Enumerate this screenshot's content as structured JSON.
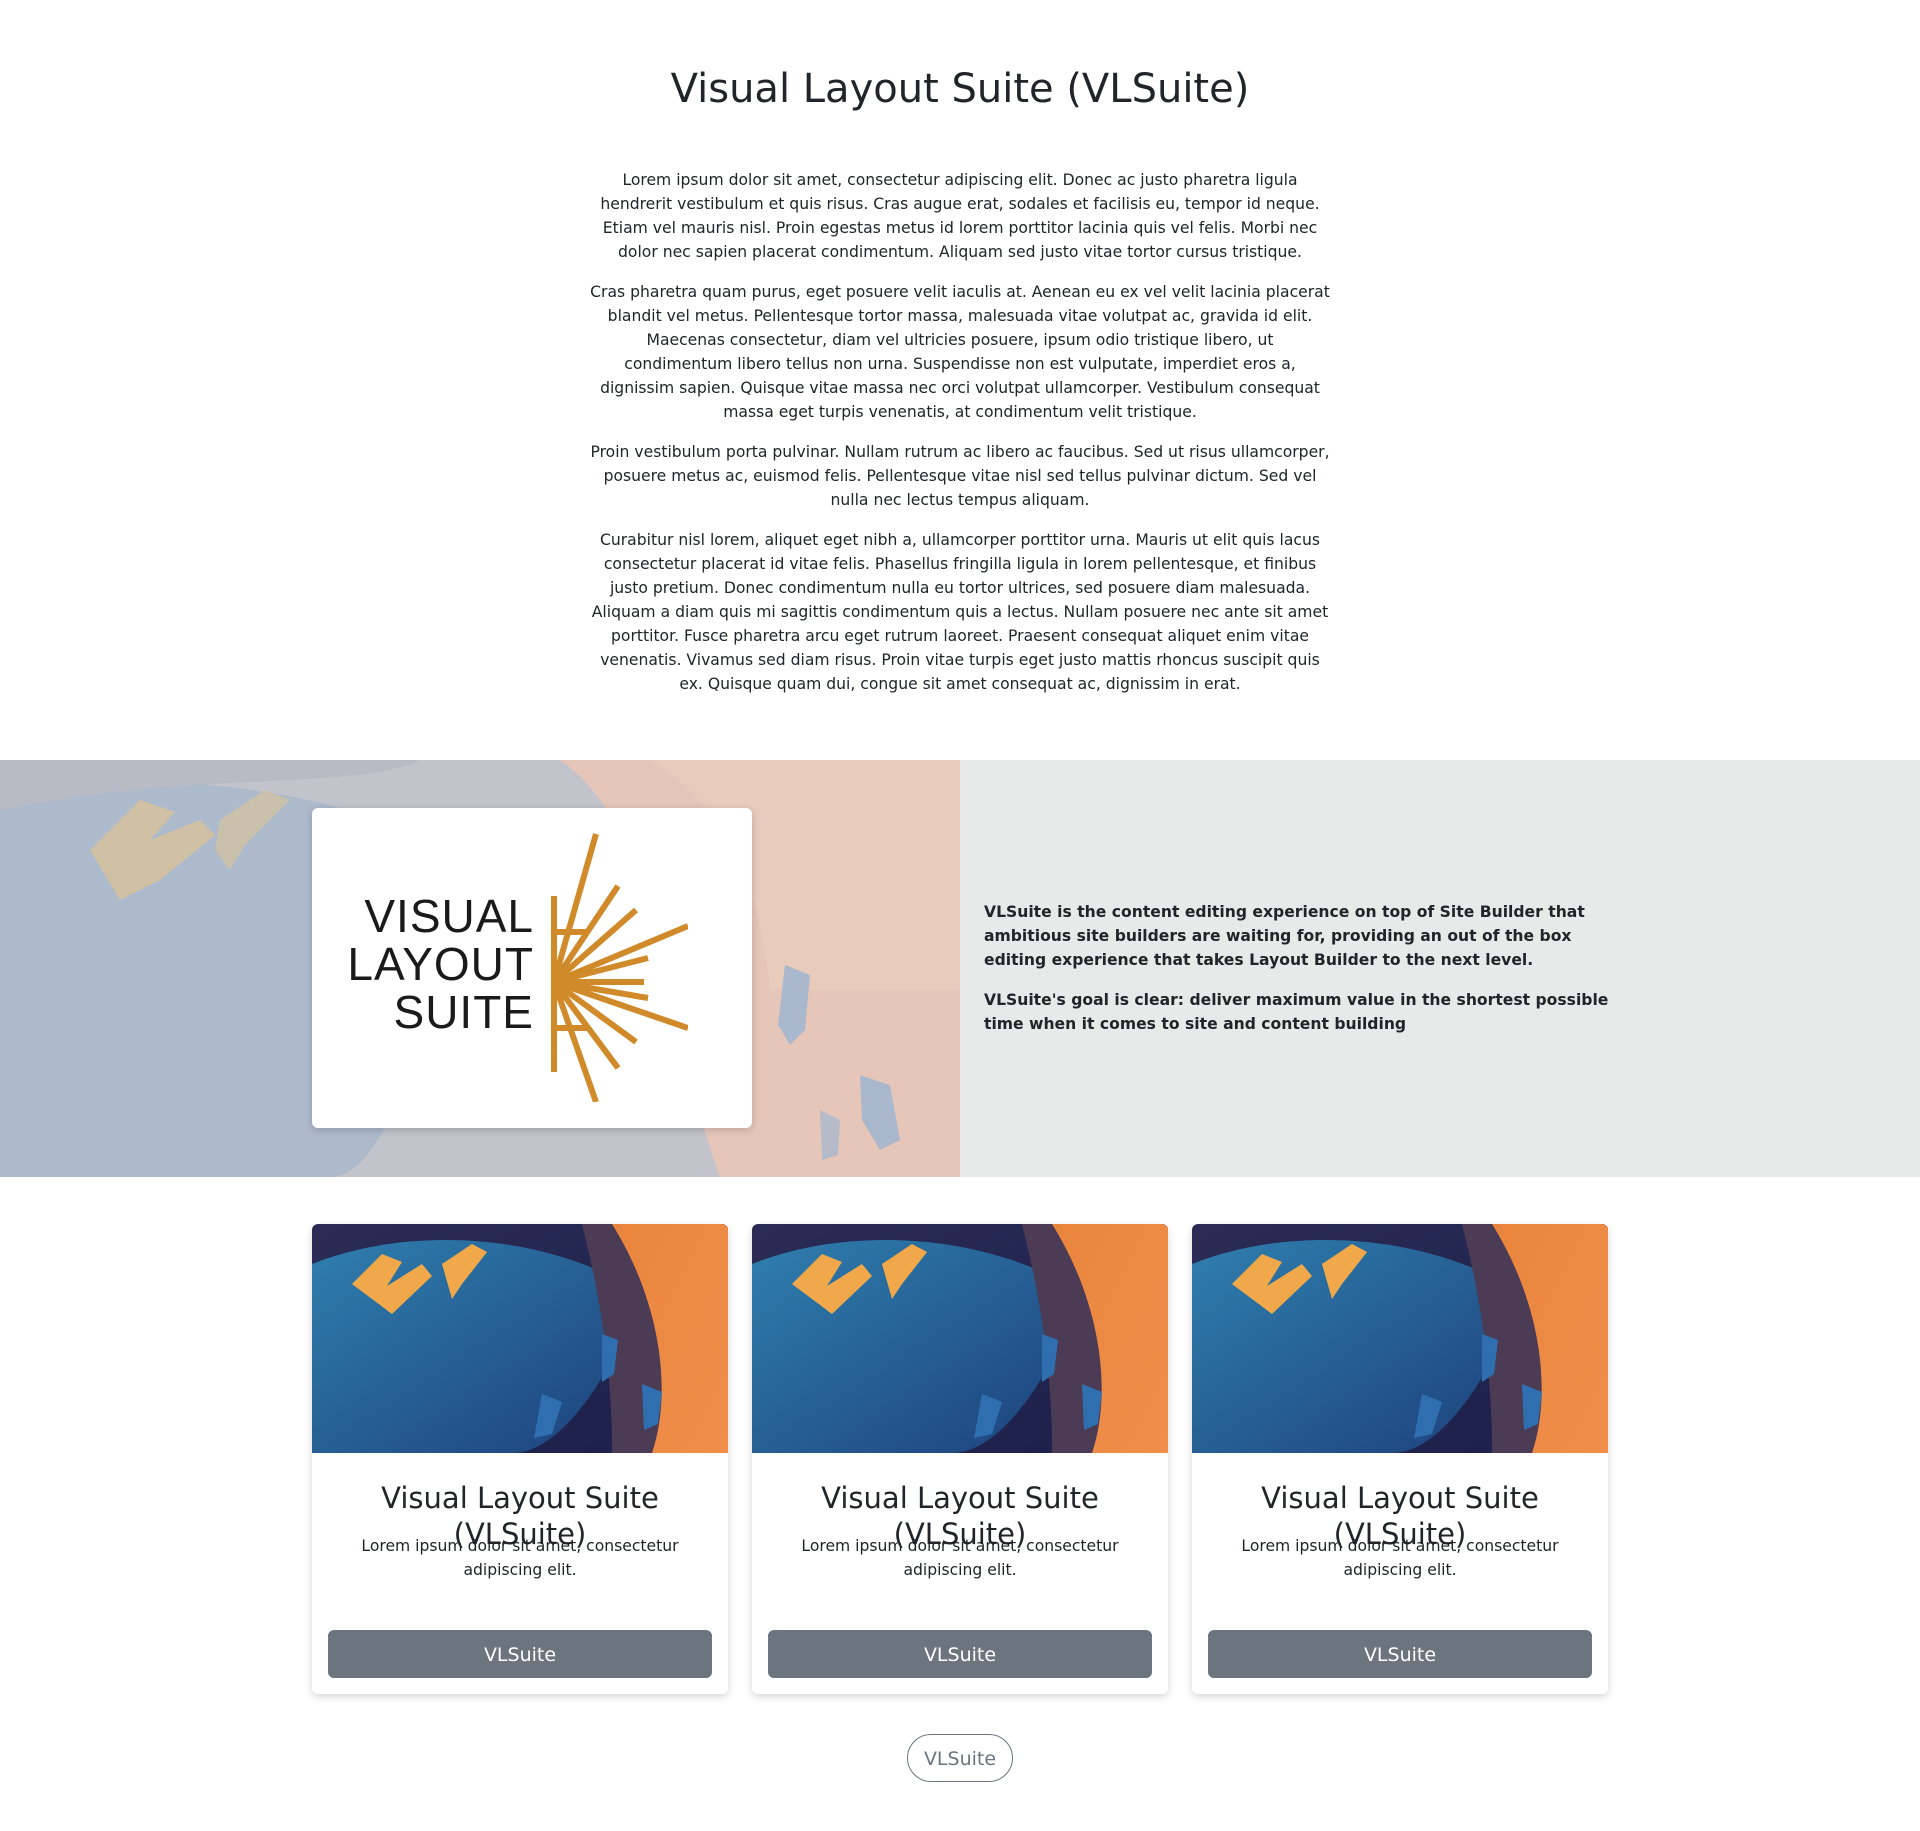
{
  "page": {
    "title": "Visual Layout Suite (VLSuite)"
  },
  "intro": {
    "paragraphs": [
      "Lorem ipsum dolor sit amet, consectetur adipiscing elit. Donec ac justo pharetra ligula hendrerit vestibulum et quis risus. Cras augue erat, sodales et facilisis eu, tempor id neque. Etiam vel mauris nisl. Proin egestas metus id lorem porttitor lacinia quis vel felis. Morbi nec dolor nec sapien placerat condimentum. Aliquam sed justo vitae tortor cursus tristique.",
      "Cras pharetra quam purus, eget posuere velit iaculis at. Aenean eu ex vel velit lacinia placerat blandit vel metus. Pellentesque tortor massa, malesuada vitae volutpat ac, gravida id elit. Maecenas consectetur, diam vel ultricies posuere, ipsum odio tristique libero, ut condimentum libero tellus non urna. Suspendisse non est vulputate, imperdiet eros a, dignissim sapien. Quisque vitae massa nec orci volutpat ullamcorper. Vestibulum consequat massa eget turpis venenatis, at condimentum velit tristique.",
      "Proin vestibulum porta pulvinar. Nullam rutrum ac libero ac faucibus. Sed ut risus ullamcorper, posuere metus ac, euismod felis. Pellentesque vitae nisl sed tellus pulvinar dictum. Sed vel nulla nec lectus tempus aliquam.",
      "Curabitur nisl lorem, aliquet eget nibh a, ullamcorper porttitor urna. Mauris ut elit quis lacus consectetur placerat id vitae felis. Phasellus fringilla ligula in lorem pellentesque, et finibus justo pretium. Donec condimentum nulla eu tortor ultrices, sed posuere diam malesuada. Aliquam a diam quis mi sagittis condimentum quis a lectus. Nullam posuere nec ante sit amet porttitor. Fusce pharetra arcu eget rutrum laoreet. Praesent consequat aliquet enim vitae venenatis. Vivamus sed diam risus. Proin vitae turpis eget justo mattis rhoncus suscipit quis ex. Quisque quam dui, congue sit amet consequat ac, dignissim in erat."
    ]
  },
  "feature": {
    "logo": {
      "line1": "VISUAL",
      "line2": "LAYOUT",
      "line3": "SUITE",
      "mark_color": "#d08a2a"
    },
    "paragraphs": [
      "VLSuite is the content editing experience on top of Site Builder that ambitious site builders are waiting for, providing an out of the box editing experience that takes Layout Builder to the next level.",
      "VLSuite's goal is clear: deliver maximum value in the shortest possible time when it comes to site and content building"
    ]
  },
  "cards": [
    {
      "title": "Visual Layout Suite (VLSuite)",
      "text": "Lorem ipsum dolor sit amet, consectetur adipiscing elit.",
      "button": "VLSuite"
    },
    {
      "title": "Visual Layout Suite (VLSuite)",
      "text": "Lorem ipsum dolor sit amet, consectetur adipiscing elit.",
      "button": "VLSuite"
    },
    {
      "title": "Visual Layout Suite (VLSuite)",
      "text": "Lorem ipsum dolor sit amet, consectetur adipiscing elit.",
      "button": "VLSuite"
    }
  ],
  "footer_button": "VLSuite",
  "colors": {
    "button_secondary": "#6c757d",
    "feature_panel": "#e8e9e9",
    "brand_orange": "#d08a2a"
  }
}
